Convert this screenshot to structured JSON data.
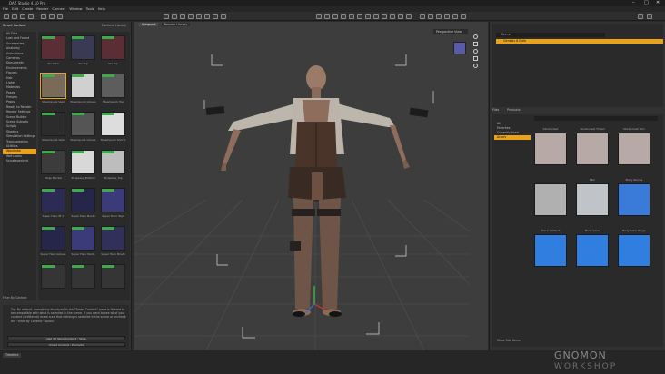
{
  "window": {
    "title": "DAZ Studio 4.10 Pro",
    "controls": [
      "–",
      "□",
      "✕"
    ]
  },
  "menu": [
    "File",
    "Edit",
    "Create",
    "Render",
    "Connect",
    "Window",
    "Tools",
    "Help"
  ],
  "left_panel": {
    "tabs": [
      "Smart Content",
      "Content Library"
    ],
    "categories": [
      "All Files",
      "Lost and Found",
      "Accessories",
      "Anatomy",
      "Animations",
      "Cameras",
      "Documents",
      "Environments",
      "Figures",
      "Hair",
      "Lights",
      "Materials",
      "Poses",
      "Presets",
      "Props",
      "Ready to Render",
      "Render Settings",
      "Scene Builder",
      "Scene Subsets",
      "Scripts",
      "Shaders",
      "Simulation Settings",
      "Transportation",
      "Utilities",
      "Wardrobe",
      "Wet Looks",
      "Uncategorized"
    ],
    "selected_category": "Wardrobe",
    "thumb_labels": [
      "Ski Shirt",
      "Ski Top",
      "Ski Top",
      "Steampunk Vest",
      "Steampunk Gloves",
      "Steampunk Top",
      "Steampunk Vest",
      "Steampunk Gloves",
      "Steampunk Shorts",
      "Strap Buckle",
      "Strapless_Bottom",
      "Strapless_Top",
      "Super Hero Pt 1",
      "Super Hero Boots",
      "Super Hero Tops",
      "Super Hero Gloves",
      "Super Hero Pants",
      "Super Hero Briefs",
      "",
      "",
      ""
    ],
    "info_text": "Tip: By default, everything displayed in the \"Smart Content\" pane is filtered to be compatible with what is selected in the scene. If you want to see all of your content (unfiltered) make sure that nothing is selected in the scene or uncheck the \"Filter By Context\" option.",
    "show_all_label": "Filter By Context",
    "button_store": "Daz 3D Store Content › Shop",
    "button_products": "Smart Content › Products"
  },
  "viewport": {
    "tabs": [
      "Viewport",
      "Render Library"
    ],
    "camera": "Perspective View"
  },
  "right_panel": {
    "scene_search": "Scene",
    "scene_item": "Genesis 8 Male",
    "smart_tabs": [
      "Files",
      "Products"
    ],
    "tree": [
      "All",
      "Favorites",
      "Currently Used",
      "Actors",
      "",
      "",
      "",
      "",
      "",
      "",
      "",
      "",
      "",
      "",
      "",
      "",
      "",
      "",
      "",
      "",
      "",
      "",
      ""
    ],
    "tree_selected": "Actors",
    "thumb_labels": [
      "Skintoolset",
      "Skintoolset Tinted",
      "Skintoolset Skin",
      "",
      "Skin",
      "Body Gloves",
      "Sheer Default",
      "Body Glow",
      "Body Glow Hinge"
    ],
    "show_sub_items": "Show Sub Items"
  },
  "status": {
    "tab": "Timeline"
  },
  "watermark": {
    "line1": "GNOMON",
    "line2": "WORKSHOP"
  },
  "colors": {
    "accent": "#e9a219",
    "new_badge": "#3faa4b",
    "viewport_bg": "#3d3d3d"
  }
}
